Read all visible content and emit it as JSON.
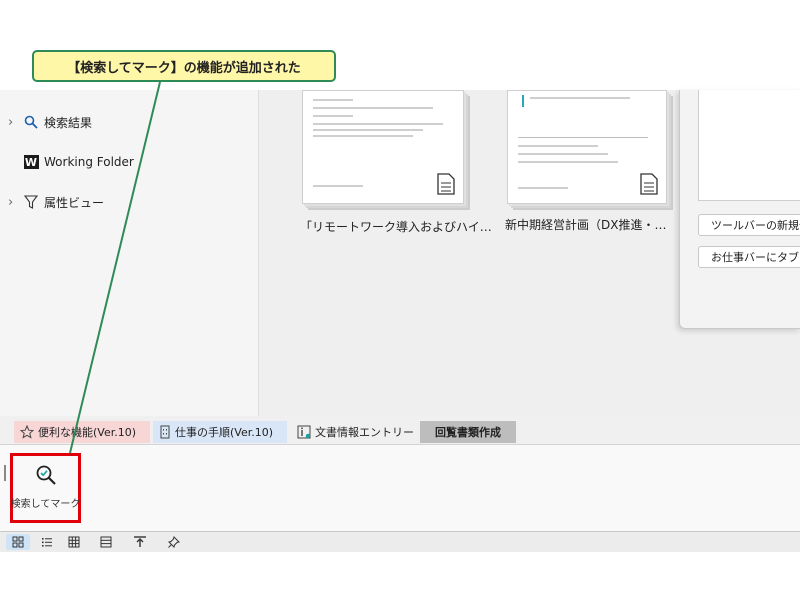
{
  "callout": {
    "text": "【検索してマーク】の機能が追加された"
  },
  "sidebar": {
    "items": [
      {
        "label": "検索結果",
        "icon": "search-icon",
        "expandable": true
      },
      {
        "label": "Working Folder",
        "icon": "working-folder-icon",
        "icon_text": "W",
        "expandable": false
      },
      {
        "label": "属性ビュー",
        "icon": "filter-icon",
        "expandable": true
      }
    ]
  },
  "documents": [
    {
      "label": "「リモートワーク導入およびハイ…"
    },
    {
      "label": "新中期経営計画（DX推進・…"
    }
  ],
  "dialog": {
    "buttons": [
      "ツールバーの新規作",
      "お仕事バーにタブを"
    ]
  },
  "tabs": [
    {
      "label": "便利な機能(Ver.10)",
      "icon": "star-icon",
      "bg": "#f9d6d6"
    },
    {
      "label": "仕事の手順(Ver.10)",
      "icon": "building-icon",
      "bg": "#d9e6f7"
    },
    {
      "label": "文書情報エントリー",
      "icon": "info-icon",
      "bg": "#f0f0f0"
    },
    {
      "label": "回覧書類作成",
      "icon": "",
      "bg": "#bdbdbd",
      "active": true
    }
  ],
  "ribbon": {
    "buttons": [
      {
        "label": "検索してマーク",
        "icon": "search-mark-icon",
        "highlighted": true
      }
    ]
  },
  "statusbar": {
    "views": [
      "thumbnail-view-icon",
      "list-view-icon",
      "grid-view-icon",
      "detail-view-icon",
      "export-view-icon",
      "pin-icon"
    ]
  },
  "colors": {
    "highlight_border": "#e0000a",
    "callout_bg": "#fff7a8",
    "callout_border": "#2e8b57",
    "leader_line": "#2e8b57"
  }
}
